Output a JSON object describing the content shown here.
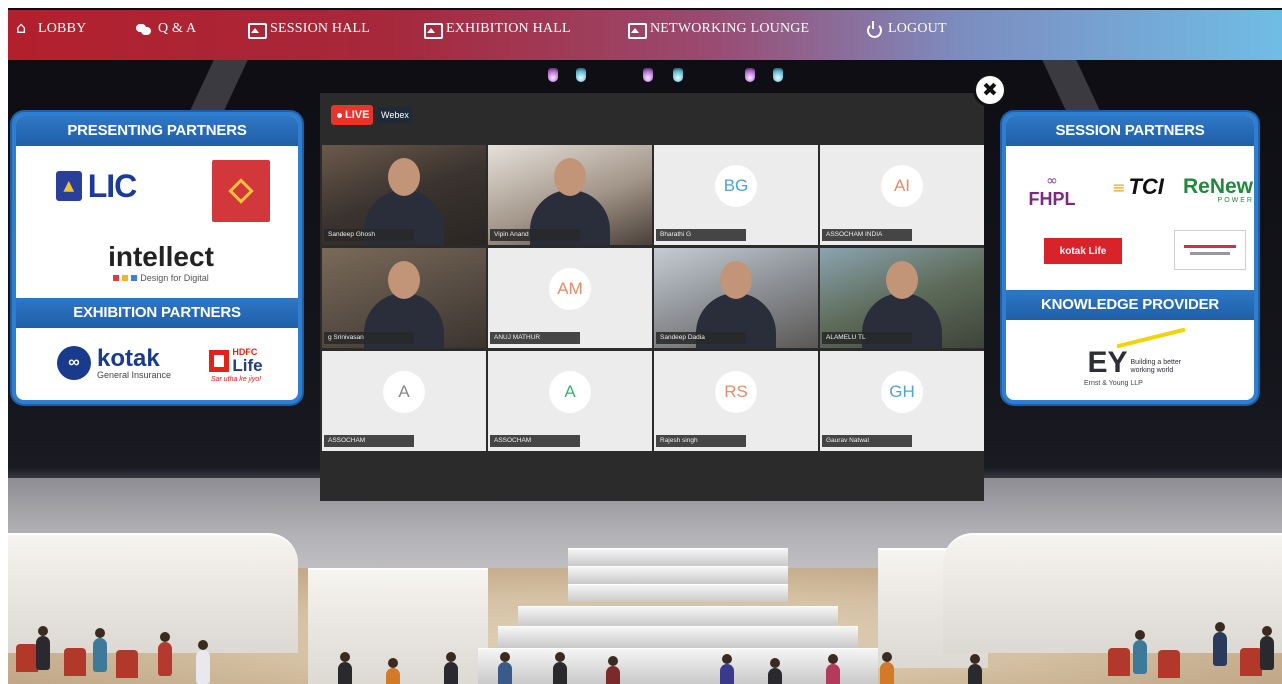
{
  "nav": {
    "items": [
      {
        "label": "LOBBY",
        "icon": "home-icon"
      },
      {
        "label": "Q & A",
        "icon": "chat-icon"
      },
      {
        "label": "SESSION HALL",
        "icon": "image-icon"
      },
      {
        "label": "EXHIBITION HALL",
        "icon": "image-icon"
      },
      {
        "label": "NETWORKING LOUNGE",
        "icon": "image-icon"
      },
      {
        "label": "LOGOUT",
        "icon": "power-icon"
      }
    ]
  },
  "left_panel": {
    "presenting_title": "PRESENTING PARTNERS",
    "exhibition_title": "EXHIBITION PARTNERS",
    "lic": "LIC",
    "intellect": "intellect",
    "intellect_tagline": "Design for Digital",
    "kotak": "kotak",
    "kotak_sub": "General Insurance",
    "hdfc_top": "HDFC",
    "hdfc_bottom": "Life",
    "hdfc_tagline": "Sar utha ke jiyo!"
  },
  "right_panel": {
    "session_title": "SESSION PARTNERS",
    "knowledge_title": "KNOWLEDGE PROVIDER",
    "fhpl": "FHPL",
    "tci": "TCI",
    "renew": "ReNew",
    "renew_sub": "POWER",
    "kotak_life": "kotak Life",
    "ey": "EY",
    "ey_tagline": "Building a better working world",
    "ey_sub": "Ernst & Young LLP"
  },
  "video": {
    "live_label": "LIVE",
    "source_label": "Webex",
    "close_symbol": "✖",
    "participants": [
      {
        "name": "Sandeep Ghosh",
        "initials": "",
        "kind": "cam-a"
      },
      {
        "name": "Vipin Anand",
        "initials": "",
        "kind": "cam-b"
      },
      {
        "name": "Bharathi G",
        "initials": "BG",
        "kind": "avatar-blue"
      },
      {
        "name": "ASSOCHAM INDIA",
        "initials": "AI",
        "kind": "avatar-orange"
      },
      {
        "name": "g Srinivasan",
        "initials": "",
        "kind": "cam-c"
      },
      {
        "name": "ANUJ MATHUR",
        "initials": "AM",
        "kind": "avatar-orange"
      },
      {
        "name": "Sandeep Dadia",
        "initials": "",
        "kind": "cam-d"
      },
      {
        "name": "ALAMELU TL",
        "initials": "",
        "kind": "cam-e"
      },
      {
        "name": "ASSOCHAM",
        "initials": "A",
        "kind": "avatar-grey"
      },
      {
        "name": "ASSOCHAM",
        "initials": "A",
        "kind": "avatar-green"
      },
      {
        "name": "Rajesh singh",
        "initials": "RS",
        "kind": "avatar-orange"
      },
      {
        "name": "Gaurav Natwal",
        "initials": "GH",
        "kind": "avatar-blue"
      }
    ]
  },
  "colors": {
    "nav_start": "#b3202d",
    "nav_end": "#6fbde6",
    "panel_blue": "#2f7fd0",
    "live_red": "#e8342a"
  }
}
